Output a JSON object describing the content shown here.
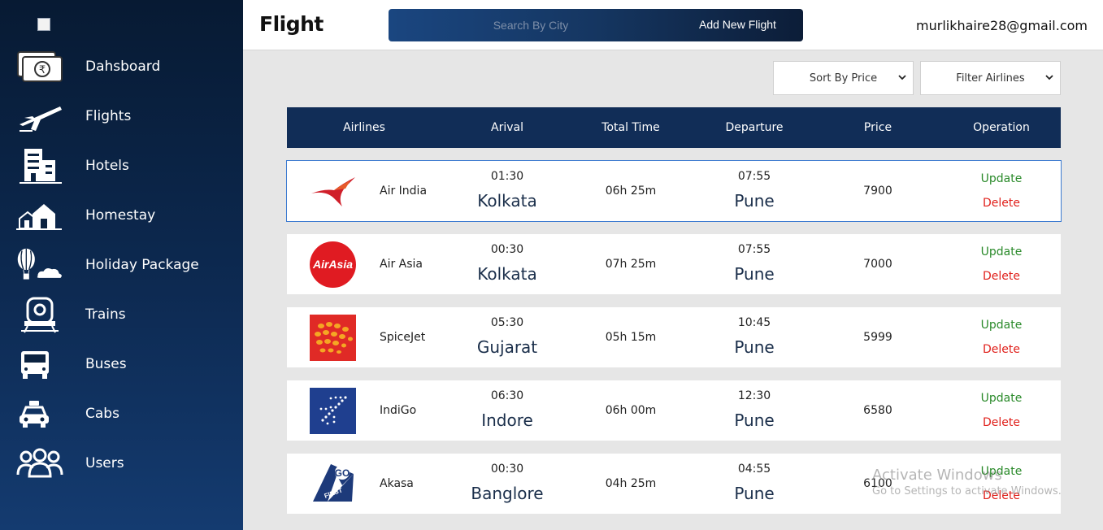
{
  "sidebar": {
    "items": [
      {
        "label": "Dahsboard",
        "icon": "rupee-cash-icon"
      },
      {
        "label": "Flights",
        "icon": "airplane-icon"
      },
      {
        "label": "Hotels",
        "icon": "building-icon"
      },
      {
        "label": "Homestay",
        "icon": "house-icon"
      },
      {
        "label": "Holiday Package",
        "icon": "hot-air-balloon-icon"
      },
      {
        "label": "Trains",
        "icon": "train-icon"
      },
      {
        "label": "Buses",
        "icon": "bus-icon"
      },
      {
        "label": "Cabs",
        "icon": "taxi-icon"
      },
      {
        "label": "Users",
        "icon": "users-icon"
      }
    ]
  },
  "header": {
    "title": "Flight",
    "search_placeholder": "Search By City",
    "add_label": "Add New Flight",
    "user_email": "murlikhaire28@gmail.com"
  },
  "filters": {
    "sort_label": "Sort By Price",
    "airline_label": "Filter Airlines"
  },
  "table": {
    "headers": [
      "Airlines",
      "Arival",
      "Total Time",
      "Departure",
      "Price",
      "Operation"
    ],
    "update_label": "Update",
    "delete_label": "Delete",
    "rows": [
      {
        "airline": "Air India",
        "logo": "air-india-logo-icon",
        "arrival_time": "01:30",
        "arrival_city": "Kolkata",
        "total": "06h 25m",
        "departure_time": "07:55",
        "departure_city": "Pune",
        "price": "7900"
      },
      {
        "airline": "Air Asia",
        "logo": "air-asia-logo-icon",
        "arrival_time": "00:30",
        "arrival_city": "Kolkata",
        "total": "07h 25m",
        "departure_time": "07:55",
        "departure_city": "Pune",
        "price": "7000"
      },
      {
        "airline": "SpiceJet",
        "logo": "spicejet-logo-icon",
        "arrival_time": "05:30",
        "arrival_city": "Gujarat",
        "total": "05h 15m",
        "departure_time": "10:45",
        "departure_city": "Pune",
        "price": "5999"
      },
      {
        "airline": "IndiGo",
        "logo": "indigo-logo-icon",
        "arrival_time": "06:30",
        "arrival_city": "Indore",
        "total": "06h 00m",
        "departure_time": "12:30",
        "departure_city": "Pune",
        "price": "6580"
      },
      {
        "airline": "Akasa",
        "logo": "go-first-logo-icon",
        "arrival_time": "00:30",
        "arrival_city": "Banglore",
        "total": "04h 25m",
        "departure_time": "04:55",
        "departure_city": "Pune",
        "price": "6100"
      }
    ]
  },
  "watermark": {
    "title": "Activate Windows",
    "subtitle": "Go to Settings to activate Windows."
  }
}
